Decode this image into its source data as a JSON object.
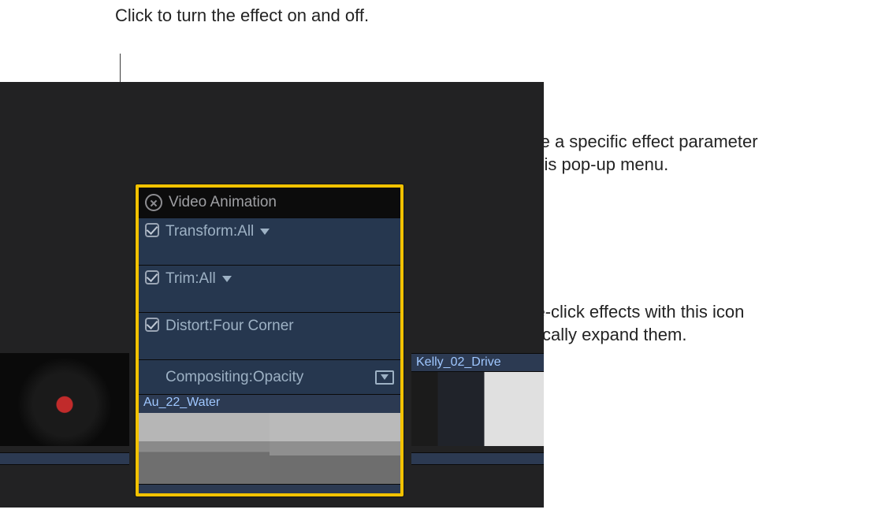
{
  "callouts": {
    "top": "Click to turn the effect on and off.",
    "right1": "Choose a specific effect parameter from this pop-up menu.",
    "right2": "Double-click effects with this icon to vertically expand them."
  },
  "panel": {
    "title": "Video Animation",
    "effects": [
      {
        "label": "Transform:All",
        "checked": true,
        "dropdown": true,
        "expand": false
      },
      {
        "label": "Trim:All",
        "checked": true,
        "dropdown": true,
        "expand": false
      },
      {
        "label": "Distort:Four Corner",
        "checked": true,
        "dropdown": false,
        "expand": false
      },
      {
        "label": "Compositing:Opacity",
        "checked": false,
        "dropdown": false,
        "expand": true
      }
    ],
    "clip_name": "Au_22_Water"
  },
  "timeline": {
    "clips": [
      {
        "name": ""
      },
      {
        "name": "Au_22_Water"
      },
      {
        "name": "Kelly_02_Drive"
      }
    ]
  },
  "colors": {
    "highlight": "#f2c200",
    "panel_bg": "#26374f",
    "text_muted": "#9db1c4"
  }
}
